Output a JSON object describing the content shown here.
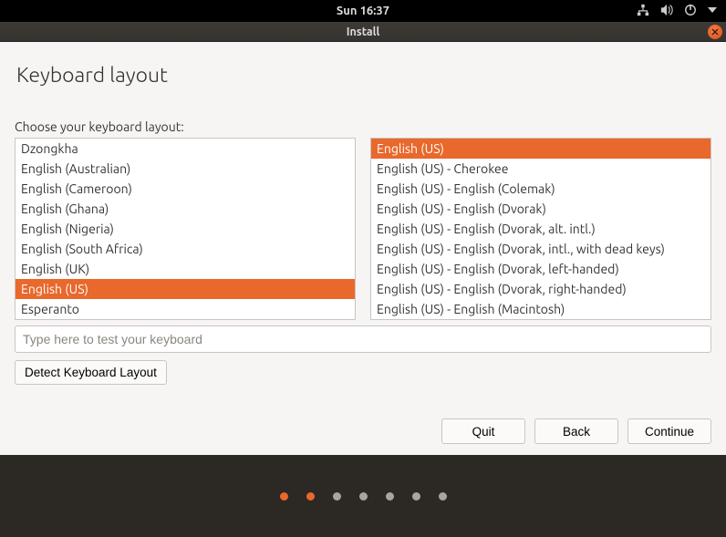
{
  "topbar": {
    "clock": "Sun 16:37"
  },
  "titlebar": {
    "title": "Install"
  },
  "page": {
    "heading": "Keyboard layout",
    "choose_label": "Choose your keyboard layout:"
  },
  "left_list": {
    "selected_index": 7,
    "items": [
      "Dzongkha",
      "English (Australian)",
      "English (Cameroon)",
      "English (Ghana)",
      "English (Nigeria)",
      "English (South Africa)",
      "English (UK)",
      "English (US)",
      "Esperanto"
    ]
  },
  "right_list": {
    "selected_index": 0,
    "items": [
      "English (US)",
      "English (US) - Cherokee",
      "English (US) - English (Colemak)",
      "English (US) - English (Dvorak)",
      "English (US) - English (Dvorak, alt. intl.)",
      "English (US) - English (Dvorak, intl., with dead keys)",
      "English (US) - English (Dvorak, left-handed)",
      "English (US) - English (Dvorak, right-handed)",
      "English (US) - English (Macintosh)"
    ]
  },
  "test_input": {
    "placeholder": "Type here to test your keyboard",
    "value": ""
  },
  "buttons": {
    "detect": "Detect Keyboard Layout",
    "quit": "Quit",
    "back": "Back",
    "continue": "Continue"
  },
  "progress_dots": {
    "count": 7,
    "active": [
      0,
      1
    ]
  }
}
